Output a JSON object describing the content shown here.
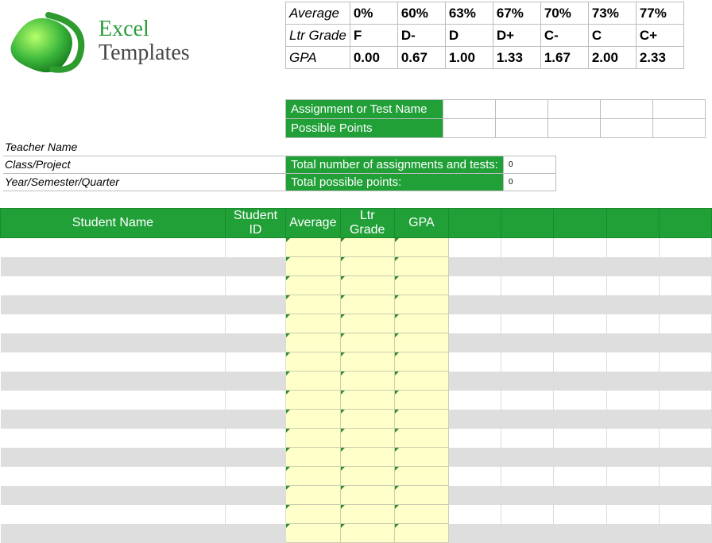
{
  "logo": {
    "line1": "Excel",
    "line2": "Templates"
  },
  "scale": {
    "rows": [
      "Average",
      "Ltr Grade",
      "GPA"
    ],
    "cols": [
      {
        "avg": "0%",
        "ltr": "F",
        "gpa": "0.00"
      },
      {
        "avg": "60%",
        "ltr": "D-",
        "gpa": "0.67"
      },
      {
        "avg": "63%",
        "ltr": "D",
        "gpa": "1.00"
      },
      {
        "avg": "67%",
        "ltr": "D+",
        "gpa": "1.33"
      },
      {
        "avg": "70%",
        "ltr": "C-",
        "gpa": "1.67"
      },
      {
        "avg": "73%",
        "ltr": "C",
        "gpa": "2.00"
      },
      {
        "avg": "77%",
        "ltr": "C+",
        "gpa": "2.33"
      }
    ]
  },
  "assign": {
    "row1": "Assignment or Test Name",
    "row2": "Possible Points"
  },
  "info": {
    "teacher": "Teacher Name",
    "class": "Class/Project",
    "year": "Year/Semester/Quarter"
  },
  "totals": {
    "label1": "Total number of assignments and tests:",
    "label2": "Total possible points:",
    "val1": "0",
    "val2": "0"
  },
  "headers": {
    "name": "Student Name",
    "id": "Student ID",
    "avg": "Average",
    "ltr": "Ltr Grade",
    "gpa": "GPA"
  },
  "studentRowCount": 16,
  "miniColCount": 5,
  "colors": {
    "green": "#21a038",
    "pale": "#feffc9"
  }
}
